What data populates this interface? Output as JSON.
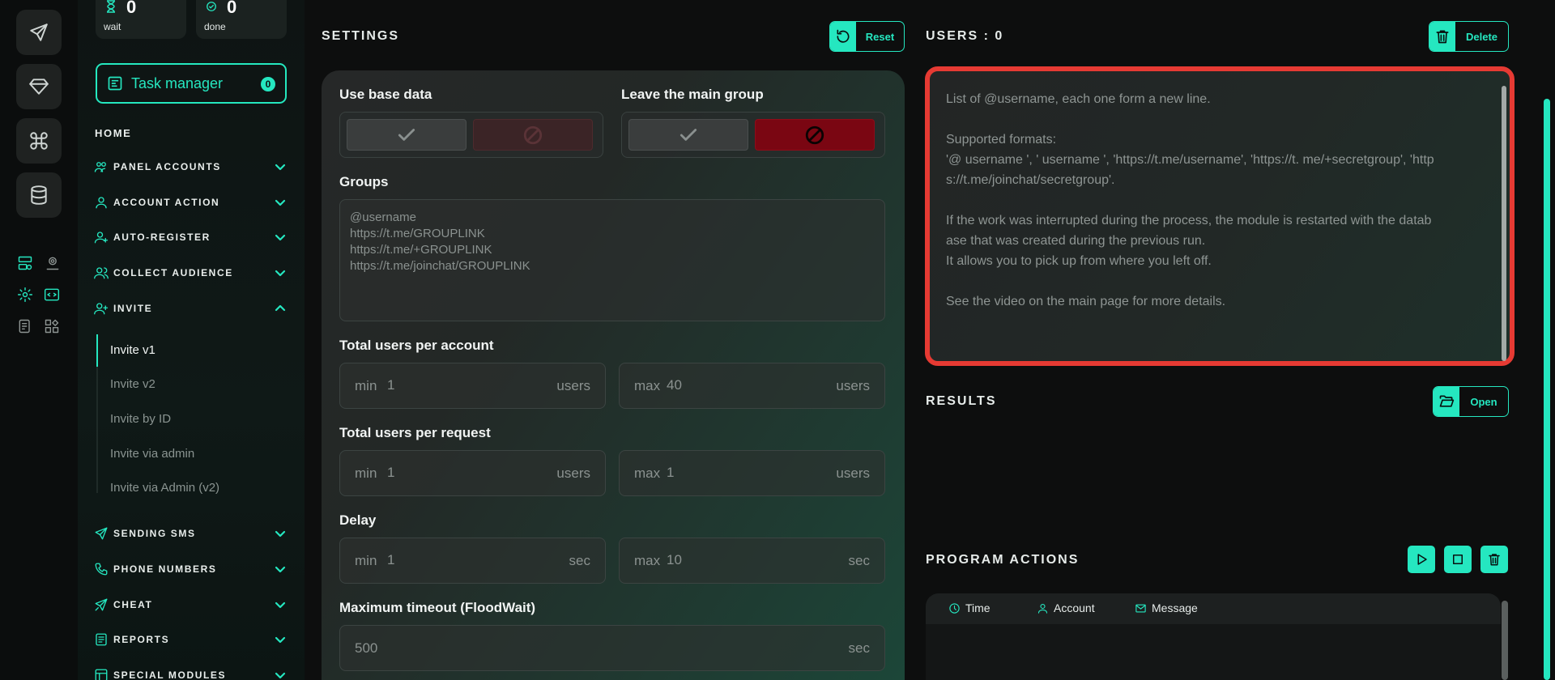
{
  "stats": [
    {
      "value": "0",
      "label": "wait",
      "icon": "hourglass-icon"
    },
    {
      "value": "0",
      "label": "done",
      "icon": "check-circle-icon"
    }
  ],
  "task_manager": {
    "label": "Task manager",
    "count": "0"
  },
  "nav": {
    "home": "HOME",
    "items": [
      {
        "label": "PANEL ACCOUNTS",
        "icon": "users-icon",
        "expanded": false
      },
      {
        "label": "ACCOUNT ACTION",
        "icon": "user-icon",
        "expanded": false
      },
      {
        "label": "AUTO-REGISTER",
        "icon": "user-plus-icon",
        "expanded": false
      },
      {
        "label": "COLLECT AUDIENCE",
        "icon": "user-group-icon",
        "expanded": false
      },
      {
        "label": "INVITE",
        "icon": "user-invite-icon",
        "expanded": true
      },
      {
        "label": "SENDING SMS",
        "icon": "send-icon",
        "expanded": false
      },
      {
        "label": "PHONE NUMBERS",
        "icon": "phone-icon",
        "expanded": false
      },
      {
        "label": "CHEAT",
        "icon": "rocket-icon",
        "expanded": false
      },
      {
        "label": "REPORTS",
        "icon": "report-icon",
        "expanded": false
      },
      {
        "label": "SPECIAL MODULES",
        "icon": "module-icon",
        "expanded": false
      }
    ],
    "invite_sub": [
      "Invite v1",
      "Invite v2",
      "Invite by ID",
      "Invite via admin",
      "Invite via Admin (v2)"
    ],
    "active_sub": "Invite v1"
  },
  "settings": {
    "title": "SETTINGS",
    "reset_label": "Reset",
    "use_base_data": {
      "label": "Use base data",
      "value": "yes"
    },
    "leave_main_group": {
      "label": "Leave the main group",
      "value": "no"
    },
    "groups": {
      "label": "Groups",
      "placeholder_lines": [
        "@username",
        "https://t.me/GROUPLINK",
        "https://t.me/+GROUPLINK",
        "https://t.me/joinchat/GROUPLINK"
      ]
    },
    "total_users_per_account": {
      "label": "Total users per account",
      "min_prefix": "min",
      "min": "1",
      "max_prefix": "max",
      "max": "40",
      "unit": "users"
    },
    "total_users_per_request": {
      "label": "Total users per request",
      "min_prefix": "min",
      "min": "1",
      "max_prefix": "max",
      "max": "1",
      "unit": "users"
    },
    "delay": {
      "label": "Delay",
      "min_prefix": "min",
      "min": "1",
      "max_prefix": "max",
      "max": "10",
      "unit": "sec"
    },
    "max_timeout": {
      "label": "Maximum timeout (FloodWait)",
      "value": "500",
      "unit": "sec"
    }
  },
  "users": {
    "title": "USERS : 0",
    "delete_label": "Delete",
    "placeholder_lines": [
      "List of @username, each one form a new line.",
      "",
      "Supported formats:",
      "'@ username ', ' username ', 'https://t.me/username', 'https://t. me/+secretgroup', 'http",
      "s://t.me/joinchat/secretgroup'.",
      "",
      "If the work was interrupted during the process, the module is restarted with the datab",
      "ase that was created during the previous run.",
      "It allows you to pick up from where you left off.",
      "",
      "See the video on the main page for more details."
    ]
  },
  "results": {
    "title": "RESULTS",
    "open_label": "Open"
  },
  "program_actions": {
    "title": "PROGRAM ACTIONS",
    "columns": [
      {
        "label": "Time",
        "icon": "clock-icon"
      },
      {
        "label": "Account",
        "icon": "user-icon"
      },
      {
        "label": "Message",
        "icon": "mail-icon"
      }
    ]
  },
  "colors": {
    "accent": "#25e7c0",
    "highlight": "#e63a33",
    "danger": "#7a0612"
  }
}
